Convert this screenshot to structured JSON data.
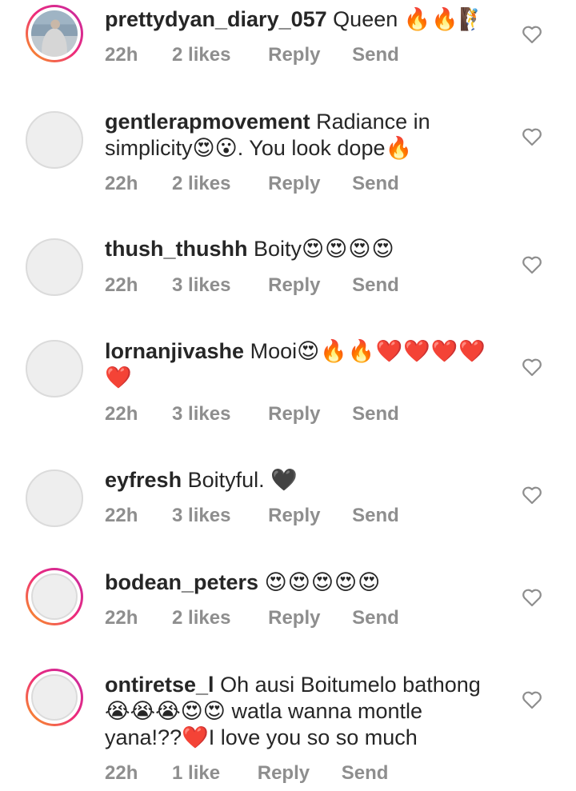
{
  "comments": [
    {
      "user": "prettydyan_diary_057",
      "text": "Queen",
      "emoji": "🔥🔥🧗",
      "time": "22h",
      "likes": "2 likes",
      "reply": "Reply",
      "send": "Send"
    },
    {
      "user": "gentlerapmovement",
      "text": "Radiance in simplicity😍😮. You look dope🔥",
      "emoji": "",
      "time": "22h",
      "likes": "2 likes",
      "reply": "Reply",
      "send": "Send"
    },
    {
      "user": "thush_thushh",
      "text": "Boity",
      "emoji": "😍😍😍😍",
      "time": "22h",
      "likes": "3 likes",
      "reply": "Reply",
      "send": "Send"
    },
    {
      "user": "lornanjivashe",
      "text": "Mooi",
      "emoji": "😍🔥🔥❤️❤️❤️❤️❤️",
      "time": "22h",
      "likes": "3 likes",
      "reply": "Reply",
      "send": "Send"
    },
    {
      "user": "eyfresh",
      "text": "Boityful.",
      "emoji": "🖤",
      "time": "22h",
      "likes": "3 likes",
      "reply": "Reply",
      "send": "Send"
    },
    {
      "user": "bodean_peters",
      "text": "",
      "emoji": "😍😍😍😍😍",
      "time": "22h",
      "likes": "2 likes",
      "reply": "Reply",
      "send": "Send"
    },
    {
      "user": "ontiretse_l",
      "text": "Oh ausi Boitumelo bathong 😭😭😭😍😍 watla wanna montle yana!??❤️I love you so so much",
      "emoji": "",
      "time": "22h",
      "likes": "1 like",
      "reply": "Reply",
      "send": "Send"
    }
  ]
}
